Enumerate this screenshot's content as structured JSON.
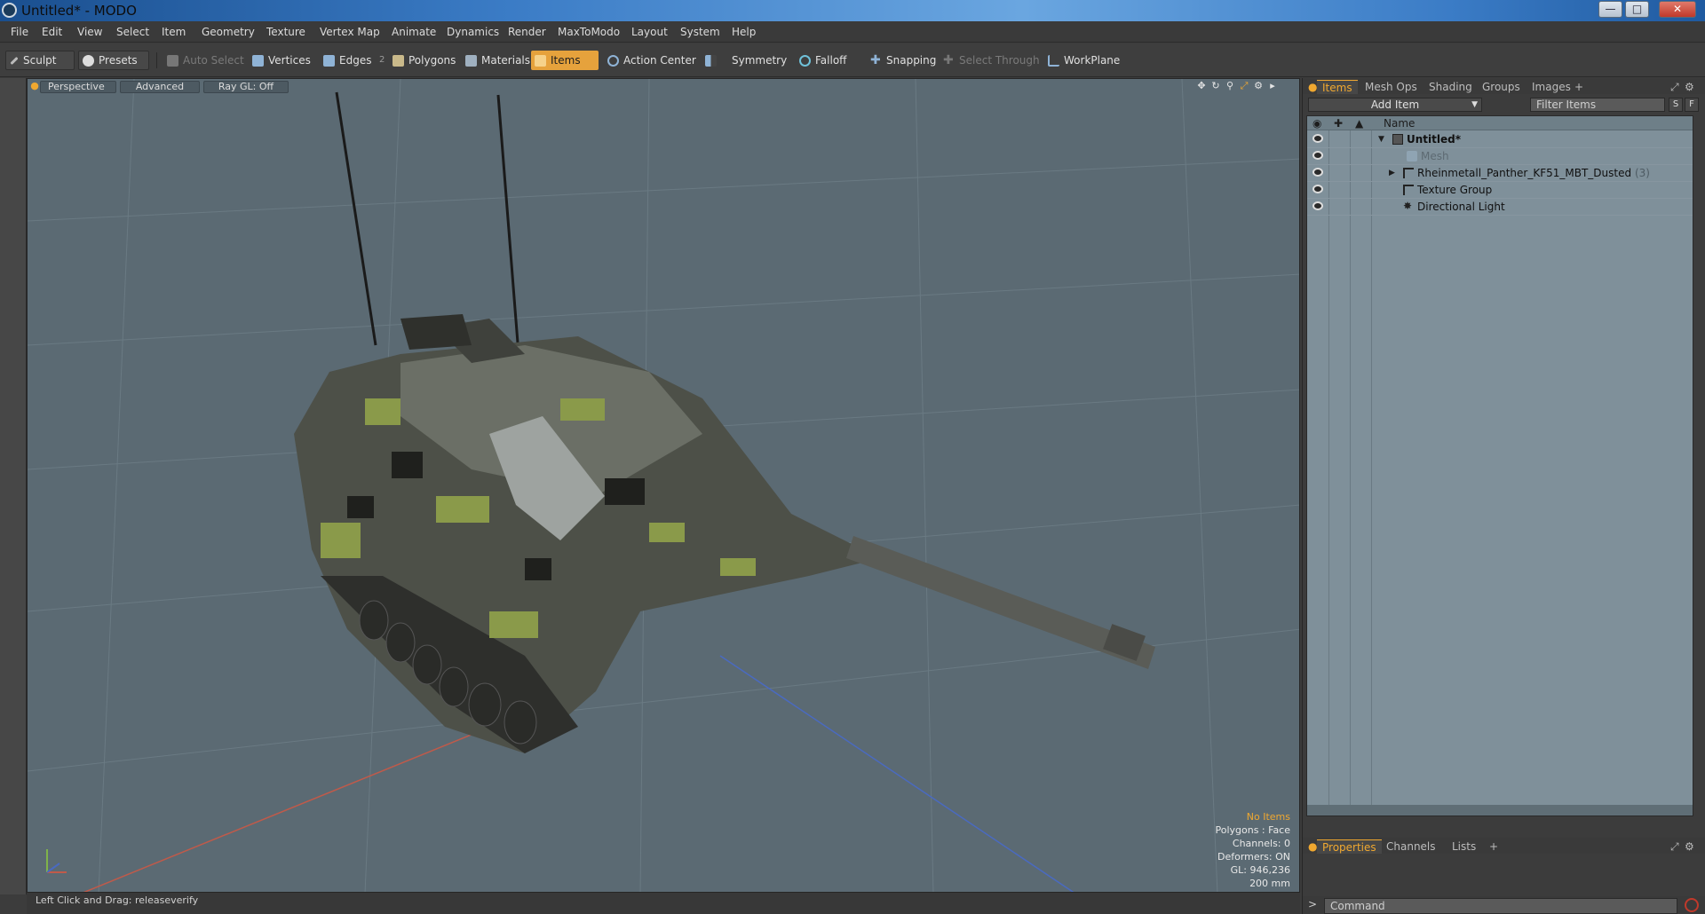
{
  "window": {
    "title": "Untitled* - MODO",
    "controls": [
      "minimize",
      "maximize",
      "close"
    ]
  },
  "menu": [
    "File",
    "Edit",
    "View",
    "Select",
    "Item",
    "Geometry",
    "Texture",
    "Vertex Map",
    "Animate",
    "Dynamics",
    "Render",
    "MaxToModo",
    "Layout",
    "System",
    "Help"
  ],
  "toolbar": {
    "sculpt": "Sculpt",
    "presets": "Presets",
    "auto_select": "Auto Select",
    "vertices": "Vertices",
    "edges": "Edges",
    "edges_count": "2",
    "polygons": "Polygons",
    "materials": "Materials",
    "items": "Items",
    "action_center": "Action Center",
    "symmetry": "Symmetry",
    "falloff": "Falloff",
    "snapping": "Snapping",
    "select_through": "Select Through",
    "workplane": "WorkPlane"
  },
  "viewport": {
    "tabs": [
      "Perspective",
      "Advanced",
      "Ray GL: Off"
    ],
    "stats": {
      "selection": "No Items",
      "polygons": "Polygons : Face",
      "channels": "Channels: 0",
      "deformers": "Deformers: ON",
      "gl": "GL: 946,236",
      "scale": "200 mm"
    }
  },
  "status": "Left Click and Drag:  releaseverify",
  "panel": {
    "tabs": [
      "Items",
      "Mesh Ops",
      "Shading",
      "Groups",
      "Images",
      "+"
    ],
    "add_item": "Add Item",
    "filter_placeholder": "Filter Items",
    "s_button": "S",
    "f_button": "F",
    "column_name": "Name",
    "tree": [
      {
        "label": "Untitled*",
        "style": "bold",
        "icon": "scene-icon"
      },
      {
        "label": "Mesh",
        "style": "dim",
        "icon": "mesh-icon"
      },
      {
        "label": "Rheinmetall_Panther_KF51_MBT_Dusted",
        "count": "(3)",
        "icon": "group-icon"
      },
      {
        "label": "Texture Group",
        "icon": "group-icon"
      },
      {
        "label": "Directional Light",
        "icon": "light-icon"
      }
    ],
    "bottom_tabs": [
      "Properties",
      "Channels",
      "Lists",
      "+"
    ],
    "command_placeholder": "Command"
  }
}
